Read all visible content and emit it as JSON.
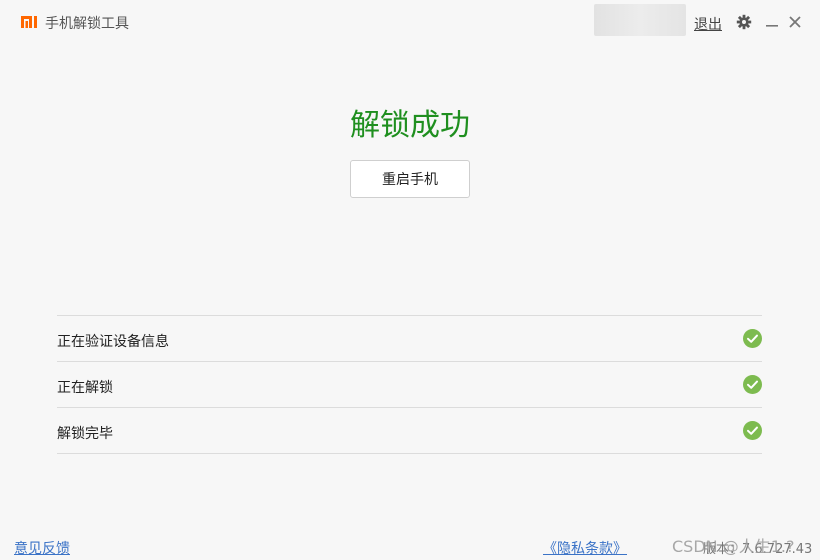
{
  "titlebar": {
    "app_title": "手机解锁工具",
    "logout": "退出",
    "logo_color": "#ff6700"
  },
  "main": {
    "result_title": "解锁成功",
    "result_color": "#1f8f1f",
    "restart_button": "重启手机"
  },
  "steps": [
    {
      "label": "正在验证设备信息",
      "status": "done"
    },
    {
      "label": "正在解锁",
      "status": "done"
    },
    {
      "label": "解锁完毕",
      "status": "done"
    }
  ],
  "footer": {
    "feedback": "意见反馈",
    "privacy": "《隐私条款》",
    "version": "版本：7.6.727.43",
    "watermark": "CSDN @人生1.?"
  },
  "colors": {
    "check_green": "#7dbb4f",
    "link_blue": "#3b73c7"
  }
}
